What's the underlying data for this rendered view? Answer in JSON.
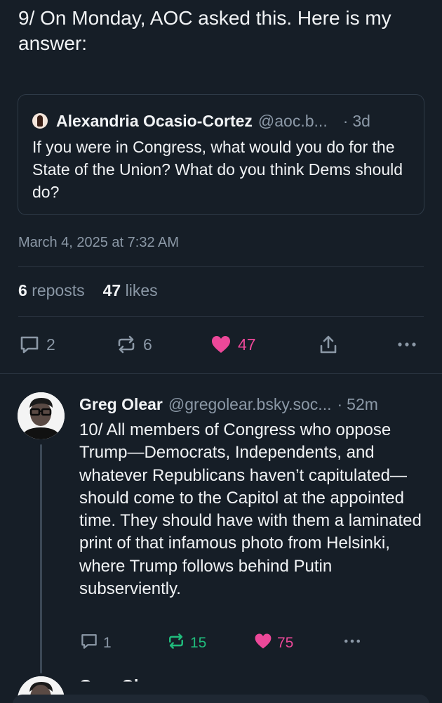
{
  "post": {
    "text": "9/ On Monday, AOC asked this. Here is my answer:",
    "quote": {
      "author_name": "Alexandria Ocasio-Cortez",
      "author_handle": "@aoc.b...",
      "separator": "·",
      "time": "3d",
      "text": "If you were in Congress, what would you do for the State of the Union? What do you think Dems should do?"
    },
    "timestamp": "March 4, 2025 at 7:32 AM",
    "stats": {
      "reposts_count": "6",
      "reposts_label": "reposts",
      "likes_count": "47",
      "likes_label": "likes"
    },
    "actions": {
      "replies": "2",
      "reposts": "6",
      "likes": "47"
    }
  },
  "reply": {
    "author_name": "Greg Olear",
    "author_handle": "@gregolear.bsky.soc...",
    "separator": "·",
    "time": "52m",
    "text": "10/ All members of Congress who oppose Trump—Democrats, Independents, and whatever Republicans haven’t capitulated—should come to the Capitol at the appointed time. They should have with them a laminated print of that infamous photo from Helsinki, where Trump follows behind Putin subserviently.",
    "actions": {
      "replies": "1",
      "reposts": "15",
      "likes": "75"
    }
  },
  "next_reply": {
    "author_name": "Greg Olear"
  },
  "colors": {
    "background": "#161e27",
    "text": "#f1f3f5",
    "muted": "#8b98a6",
    "like": "#ec4899",
    "repost": "#20bc7c"
  },
  "icons": [
    "reply-icon",
    "repost-icon",
    "heart-icon",
    "share-icon",
    "more-icon"
  ]
}
